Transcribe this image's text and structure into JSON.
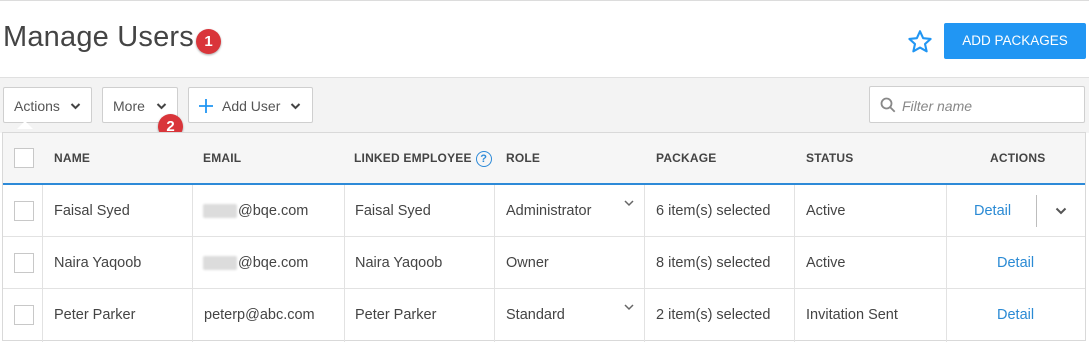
{
  "page": {
    "title": "Manage Users",
    "badge1": "1",
    "badge2": "2",
    "star_icon": "star-outline-icon",
    "add_packages_label": "ADD PACKAGES",
    "accent_color": "#2196f3",
    "badge_color": "#d9353a"
  },
  "toolbar": {
    "actions_label": "Actions",
    "more_label": "More",
    "add_user_label": "Add User",
    "filter_placeholder": "Filter name"
  },
  "table": {
    "columns": [
      "NAME",
      "EMAIL",
      "LINKED EMPLOYEE",
      "ROLE",
      "PACKAGE",
      "STATUS",
      "ACTIONS"
    ],
    "rows": [
      {
        "name": "Faisal Syed",
        "email": "@bqe.com",
        "email_redacted": true,
        "linked_employee": "Faisal Syed",
        "role": "Administrator",
        "role_dropdown": true,
        "package": "6 item(s) selected",
        "status": "Active",
        "action": "Detail",
        "action_menu": true
      },
      {
        "name": "Naira Yaqoob",
        "email": "@bqe.com",
        "email_redacted": true,
        "linked_employee": "Naira Yaqoob",
        "role": "Owner",
        "role_dropdown": false,
        "package": "8 item(s) selected",
        "status": "Active",
        "action": "Detail",
        "action_menu": false
      },
      {
        "name": "Peter Parker",
        "email": "peterp@abc.com",
        "email_redacted": false,
        "linked_employee": "Peter Parker",
        "role": "Standard",
        "role_dropdown": true,
        "package": "2 item(s) selected",
        "status": "Invitation Sent",
        "action": "Detail",
        "action_menu": false
      }
    ]
  }
}
